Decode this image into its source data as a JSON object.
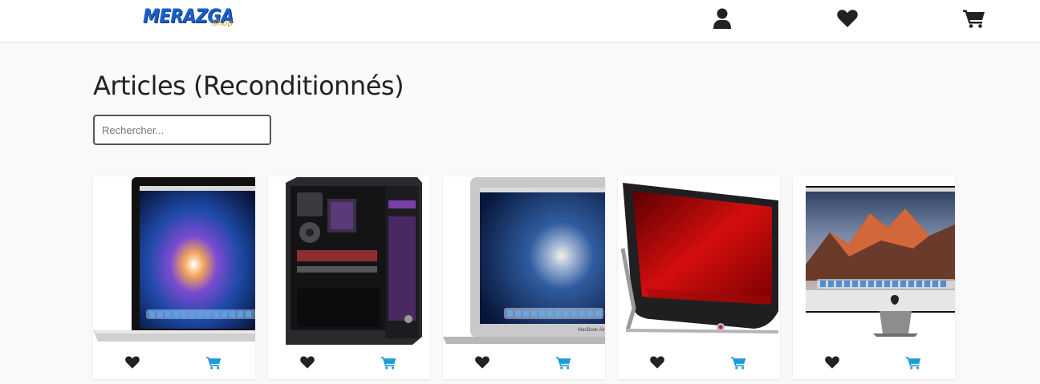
{
  "header": {
    "logo_text": "MERAZGA",
    "logo_sub": "Shop",
    "icons": [
      "user-icon",
      "heart-icon",
      "cart-icon"
    ]
  },
  "page": {
    "title": "Articles (Reconditionnés)"
  },
  "search": {
    "placeholder": "Rechercher..."
  },
  "colors": {
    "accent": "#1e9bd7",
    "icon_dark": "#222222",
    "logo_blue": "#1b5fc9",
    "logo_gold": "#d4a017"
  },
  "products": [
    {
      "image": "macbook-pro-galaxy-image",
      "fav_icon": "heart-icon",
      "cart_icon": "cart-icon"
    },
    {
      "image": "desktop-tower-image",
      "fav_icon": "heart-icon",
      "cart_icon": "cart-icon"
    },
    {
      "image": "macbook-air-image",
      "screen_label": "MacBook Air",
      "fav_icon": "heart-icon",
      "cart_icon": "cart-icon"
    },
    {
      "image": "all-in-one-pc-image",
      "fav_icon": "heart-icon",
      "cart_icon": "cart-icon"
    },
    {
      "image": "imac-image",
      "fav_icon": "heart-icon",
      "cart_icon": "cart-icon"
    }
  ]
}
